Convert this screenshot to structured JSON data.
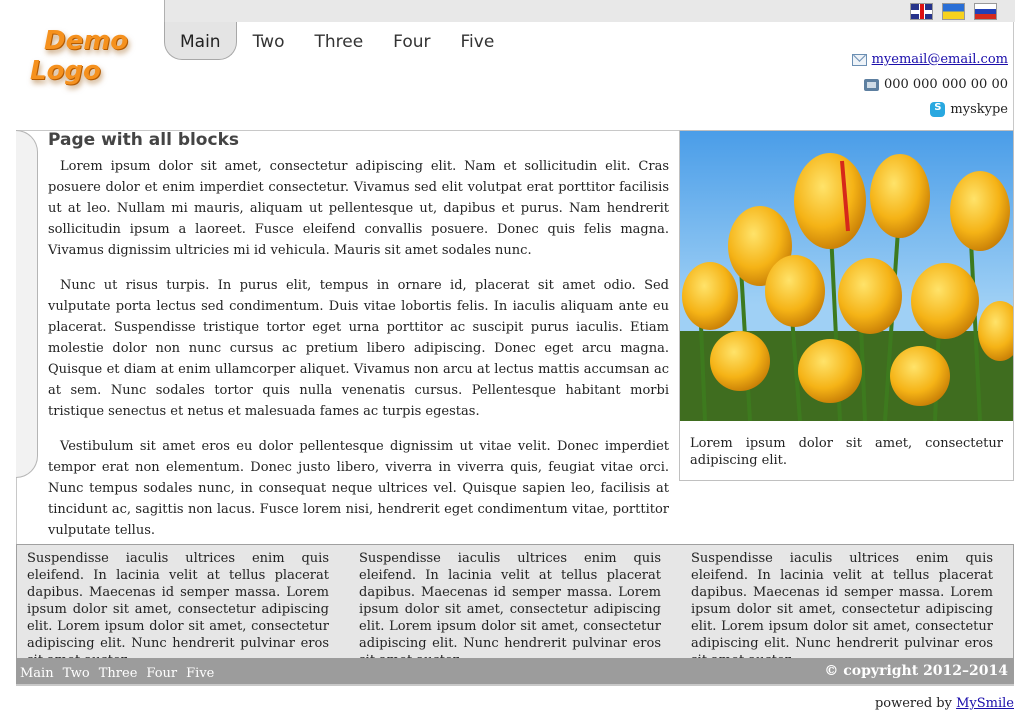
{
  "logo": {
    "line1": "Demo",
    "line2": "Logo"
  },
  "languages": [
    {
      "icon": "uk-flag-icon"
    },
    {
      "icon": "ua-flag-icon"
    },
    {
      "icon": "ru-flag-icon"
    }
  ],
  "nav": {
    "items": [
      "Main",
      "Two",
      "Three",
      "Four",
      "Five"
    ],
    "active": "Main"
  },
  "contacts": {
    "email": "myemail@email.com",
    "phone": "000 000 000 00 00",
    "skype": "myskype"
  },
  "article": {
    "title": "Page with all blocks",
    "paragraphs": [
      "Lorem ipsum dolor sit amet, consectetur adipiscing elit. Nam et sollicitudin elit. Cras posuere dolor et enim imperdiet consectetur. Vivamus sed elit volutpat erat porttitor facilisis ut at leo. Nullam mi mauris, aliquam ut pellentesque ut, dapibus et purus. Nam hendrerit sollicitudin ipsum a laoreet. Fusce eleifend convallis posuere. Donec quis felis magna. Vivamus dignissim ultricies mi id vehicula. Mauris sit amet sodales nunc.",
      "Nunc ut risus turpis. In purus elit, tempus in ornare id, placerat sit amet odio. Sed vulputate porta lectus sed condimentum. Duis vitae lobortis felis. In iaculis aliquam ante eu placerat. Suspendisse tristique tortor eget urna porttitor ac suscipit purus iaculis. Etiam molestie dolor non nunc cursus ac pretium libero adipiscing. Donec eget arcu magna. Quisque et diam at enim ullamcorper aliquet. Vivamus non arcu at lectus mattis accumsan ac at sem. Nunc sodales tortor quis nulla venenatis cursus. Pellentesque habitant morbi tristique senectus et netus et malesuada fames ac turpis egestas.",
      "Vestibulum sit amet eros eu dolor pellentesque dignissim ut vitae velit. Donec imperdiet tempor erat non elementum. Donec justo libero, viverra in viverra quis, feugiat vitae orci. Nunc tempus sodales nunc, in consequat neque ultrices vel. Quisque sapien leo, facilisis at tincidunt ac, sagittis non lacus. Fusce lorem nisi, hendrerit eget condimentum vitae, porttitor vulputate tellus."
    ]
  },
  "photo": {
    "caption": "Lorem ipsum dolor sit amet, consectetur adipiscing elit."
  },
  "footer": {
    "blocks": [
      "Suspendisse iaculis ultrices enim quis eleifend. In lacinia velit at tellus placerat dapibus. Maecenas id semper massa. Lorem ipsum dolor sit amet, consectetur adipiscing elit. Lorem ipsum dolor sit amet, consectetur adipiscing elit. Nunc hendrerit pulvinar eros sit amet auctor.",
      "Suspendisse iaculis ultrices enim quis eleifend. In lacinia velit at tellus placerat dapibus. Maecenas id semper massa. Lorem ipsum dolor sit amet, consectetur adipiscing elit. Lorem ipsum dolor sit amet, consectetur adipiscing elit. Nunc hendrerit pulvinar eros sit amet auctor.",
      "Suspendisse iaculis ultrices enim quis eleifend. In lacinia velit at tellus placerat dapibus. Maecenas id semper massa. Lorem ipsum dolor sit amet, consectetur adipiscing elit. Lorem ipsum dolor sit amet, consectetur adipiscing elit. Nunc hendrerit pulvinar eros sit amet auctor."
    ],
    "nav": [
      "Main",
      "Two",
      "Three",
      "Four",
      "Five"
    ],
    "copyright": "© copyright 2012–2014",
    "powered_prefix": "powered by ",
    "powered_link": "MySmile"
  },
  "colors": {
    "logo": "#f5911e",
    "footer_bar": "#9c9c9c",
    "footer_blocks": "#e6e6e6",
    "link": "#1a0dab"
  }
}
